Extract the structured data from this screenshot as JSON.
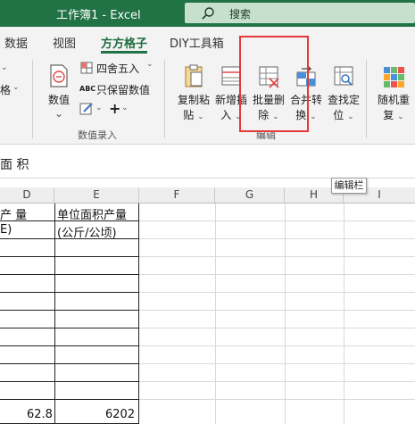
{
  "titlebar": {
    "title": "工作簿1  -  Excel",
    "search_label": "搜索"
  },
  "tabs": {
    "items": [
      "数据",
      "视图",
      "方方格子",
      "DIY工具箱"
    ],
    "active": "方方格子"
  },
  "ribbon": {
    "left_partial": {
      "item1": "格",
      "chev1": "⌄",
      "chev2": "⌄"
    },
    "numeric_group": {
      "value_label": "数值",
      "round_label": "四舍五入",
      "keep_label": "只保留数值",
      "group_label": "数值录入"
    },
    "edit_group": {
      "copy_paste": [
        "复制粘",
        "贴"
      ],
      "insert": [
        "新增插",
        "入"
      ],
      "batch_delete": [
        "批量删",
        "除"
      ],
      "merge_convert": [
        "合并转",
        "换"
      ],
      "find_locate": [
        "查找定",
        "位"
      ],
      "group_label": "编辑"
    },
    "random_group": {
      "random_dup": [
        "随机重",
        "复"
      ]
    },
    "highlight_color": "#e53935"
  },
  "formulabar": {
    "text": "面 积",
    "tooltip": "编辑栏"
  },
  "columns": [
    "D",
    "E",
    "F",
    "G",
    "H",
    "I"
  ],
  "cells": {
    "d1": "产    量",
    "e1": "单位面积产量",
    "d2": "E)",
    "e2": "(公斤/公顷)",
    "d_last": "62.8",
    "e_last": "6202"
  },
  "colors": {
    "excel_green": "#217346",
    "search_bg": "#c6e0cd",
    "ribbon_bg": "#f3f3f3"
  }
}
